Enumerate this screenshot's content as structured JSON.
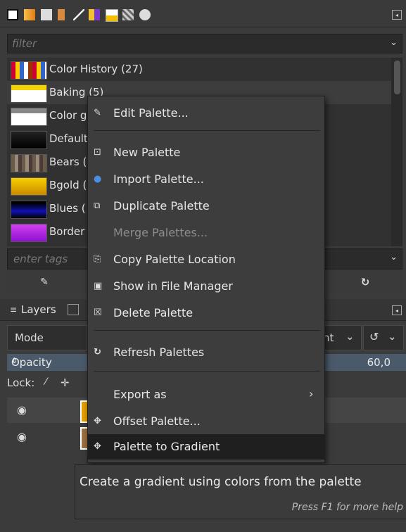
{
  "filter": {
    "placeholder": "filter"
  },
  "palettes": [
    {
      "name": "Color History (27)"
    },
    {
      "name": "Baking (5)"
    },
    {
      "name": "Color g"
    },
    {
      "name": "Default"
    },
    {
      "name": "Bears ("
    },
    {
      "name": "Bgold ("
    },
    {
      "name": "Blues ("
    },
    {
      "name": "Border"
    }
  ],
  "tags": {
    "placeholder": "enter tags"
  },
  "layers": {
    "tab_label": "Layers"
  },
  "mode": {
    "label": "Mode",
    "value_suffix": "nt"
  },
  "opacity": {
    "label": "Opacity",
    "value": "60,0"
  },
  "lock": {
    "label": "Lock:"
  },
  "menu": {
    "edit": "Edit Palette...",
    "new": "New Palette",
    "import": "Import Palette...",
    "duplicate": "Duplicate Palette",
    "merge": "Merge Palettes...",
    "copy_location": "Copy Palette Location",
    "show_in_manager": "Show in File Manager",
    "delete": "Delete Palette",
    "refresh": "Refresh Palettes",
    "export": "Export as",
    "offset": "Offset Palette...",
    "to_gradient": "Palette to Gradient"
  },
  "tooltip": {
    "text": "Create a gradient using colors from the palette",
    "help": "Press F1 for more help"
  },
  "icons": {
    "edit": "edit-icon",
    "new": "new-icon",
    "import": "import-icon",
    "duplicate": "duplicate-icon",
    "copy": "copy-icon",
    "file_manager": "file-manager-icon",
    "delete": "delete-icon",
    "refresh": "refresh-icon",
    "submenu": "chevron-right-icon",
    "offset": "offset-icon",
    "gradient": "gradient-icon"
  }
}
